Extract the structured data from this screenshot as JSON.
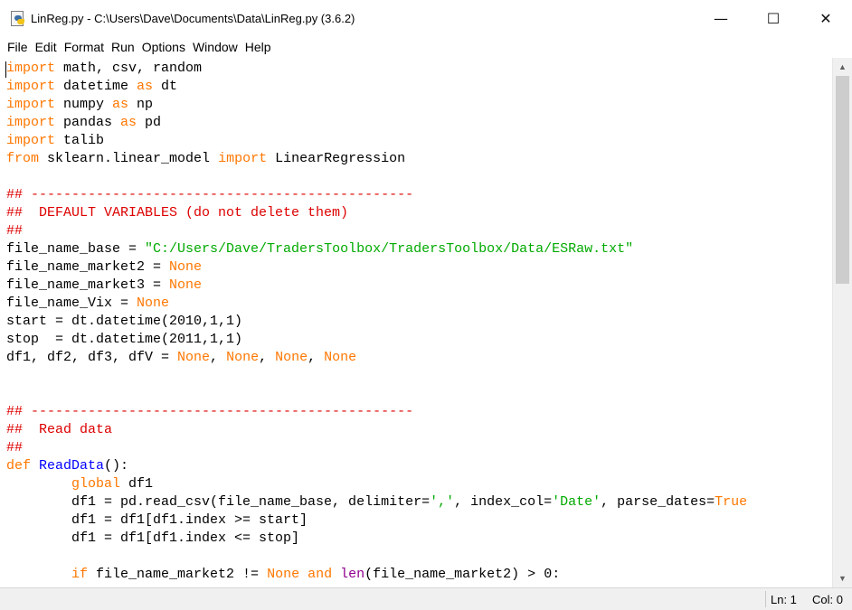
{
  "window": {
    "title": "LinReg.py - C:\\Users\\Dave\\Documents\\Data\\LinReg.py (3.6.2)",
    "icon": "python-file-icon",
    "controls": {
      "minimize": "—",
      "maximize": "☐",
      "close": "✕"
    }
  },
  "menu": [
    "File",
    "Edit",
    "Format",
    "Run",
    "Options",
    "Window",
    "Help"
  ],
  "syntax_colors": {
    "keyword": "#ff7700",
    "comment": "#dd0000",
    "string": "#00aa00",
    "definition": "#0000ff",
    "builtin": "#900090"
  },
  "code_lines": [
    [
      {
        "t": "import",
        "c": "kw"
      },
      {
        "t": " math, csv, random"
      }
    ],
    [
      {
        "t": "import",
        "c": "kw"
      },
      {
        "t": " datetime "
      },
      {
        "t": "as",
        "c": "kw"
      },
      {
        "t": " dt"
      }
    ],
    [
      {
        "t": "import",
        "c": "kw"
      },
      {
        "t": " numpy "
      },
      {
        "t": "as",
        "c": "kw"
      },
      {
        "t": " np"
      }
    ],
    [
      {
        "t": "import",
        "c": "kw"
      },
      {
        "t": " pandas "
      },
      {
        "t": "as",
        "c": "kw"
      },
      {
        "t": " pd"
      }
    ],
    [
      {
        "t": "import",
        "c": "kw"
      },
      {
        "t": " talib"
      }
    ],
    [
      {
        "t": "from",
        "c": "kw"
      },
      {
        "t": " sklearn.linear_model "
      },
      {
        "t": "import",
        "c": "kw"
      },
      {
        "t": " LinearRegression"
      }
    ],
    [],
    [
      {
        "t": "## -----------------------------------------------",
        "c": "cm"
      }
    ],
    [
      {
        "t": "##  DEFAULT VARIABLES (do not delete them)",
        "c": "cm"
      }
    ],
    [
      {
        "t": "##",
        "c": "cm"
      }
    ],
    [
      {
        "t": "file_name_base = "
      },
      {
        "t": "\"C:/Users/Dave/TradersToolbox/TradersToolbox/Data/ESRaw.txt\"",
        "c": "st"
      }
    ],
    [
      {
        "t": "file_name_market2 = "
      },
      {
        "t": "None",
        "c": "kw"
      }
    ],
    [
      {
        "t": "file_name_market3 = "
      },
      {
        "t": "None",
        "c": "kw"
      }
    ],
    [
      {
        "t": "file_name_Vix = "
      },
      {
        "t": "None",
        "c": "kw"
      }
    ],
    [
      {
        "t": "start = dt.datetime(2010,1,1)"
      }
    ],
    [
      {
        "t": "stop  = dt.datetime(2011,1,1)"
      }
    ],
    [
      {
        "t": "df1, df2, df3, dfV = "
      },
      {
        "t": "None",
        "c": "kw"
      },
      {
        "t": ", "
      },
      {
        "t": "None",
        "c": "kw"
      },
      {
        "t": ", "
      },
      {
        "t": "None",
        "c": "kw"
      },
      {
        "t": ", "
      },
      {
        "t": "None",
        "c": "kw"
      }
    ],
    [],
    [],
    [
      {
        "t": "## -----------------------------------------------",
        "c": "cm"
      }
    ],
    [
      {
        "t": "##  Read data",
        "c": "cm"
      }
    ],
    [
      {
        "t": "##",
        "c": "cm"
      }
    ],
    [
      {
        "t": "def",
        "c": "kw"
      },
      {
        "t": " "
      },
      {
        "t": "ReadData",
        "c": "df"
      },
      {
        "t": "():"
      }
    ],
    [
      {
        "t": "        "
      },
      {
        "t": "global",
        "c": "kw"
      },
      {
        "t": " df1"
      }
    ],
    [
      {
        "t": "        df1 = pd.read_csv(file_name_base, delimiter="
      },
      {
        "t": "','",
        "c": "st"
      },
      {
        "t": ", index_col="
      },
      {
        "t": "'Date'",
        "c": "st"
      },
      {
        "t": ", parse_dates="
      },
      {
        "t": "True",
        "c": "kw"
      }
    ],
    [
      {
        "t": "        df1 = df1[df1.index >= start]"
      }
    ],
    [
      {
        "t": "        df1 = df1[df1.index <= stop]"
      }
    ],
    [],
    [
      {
        "t": "        "
      },
      {
        "t": "if",
        "c": "kw"
      },
      {
        "t": " file_name_market2 != "
      },
      {
        "t": "None",
        "c": "kw"
      },
      {
        "t": " "
      },
      {
        "t": "and",
        "c": "kw"
      },
      {
        "t": " "
      },
      {
        "t": "len",
        "c": "bi"
      },
      {
        "t": "(file_name_market2) > 0:"
      }
    ]
  ],
  "status": {
    "line": "Ln: 1",
    "col": "Col: 0"
  }
}
